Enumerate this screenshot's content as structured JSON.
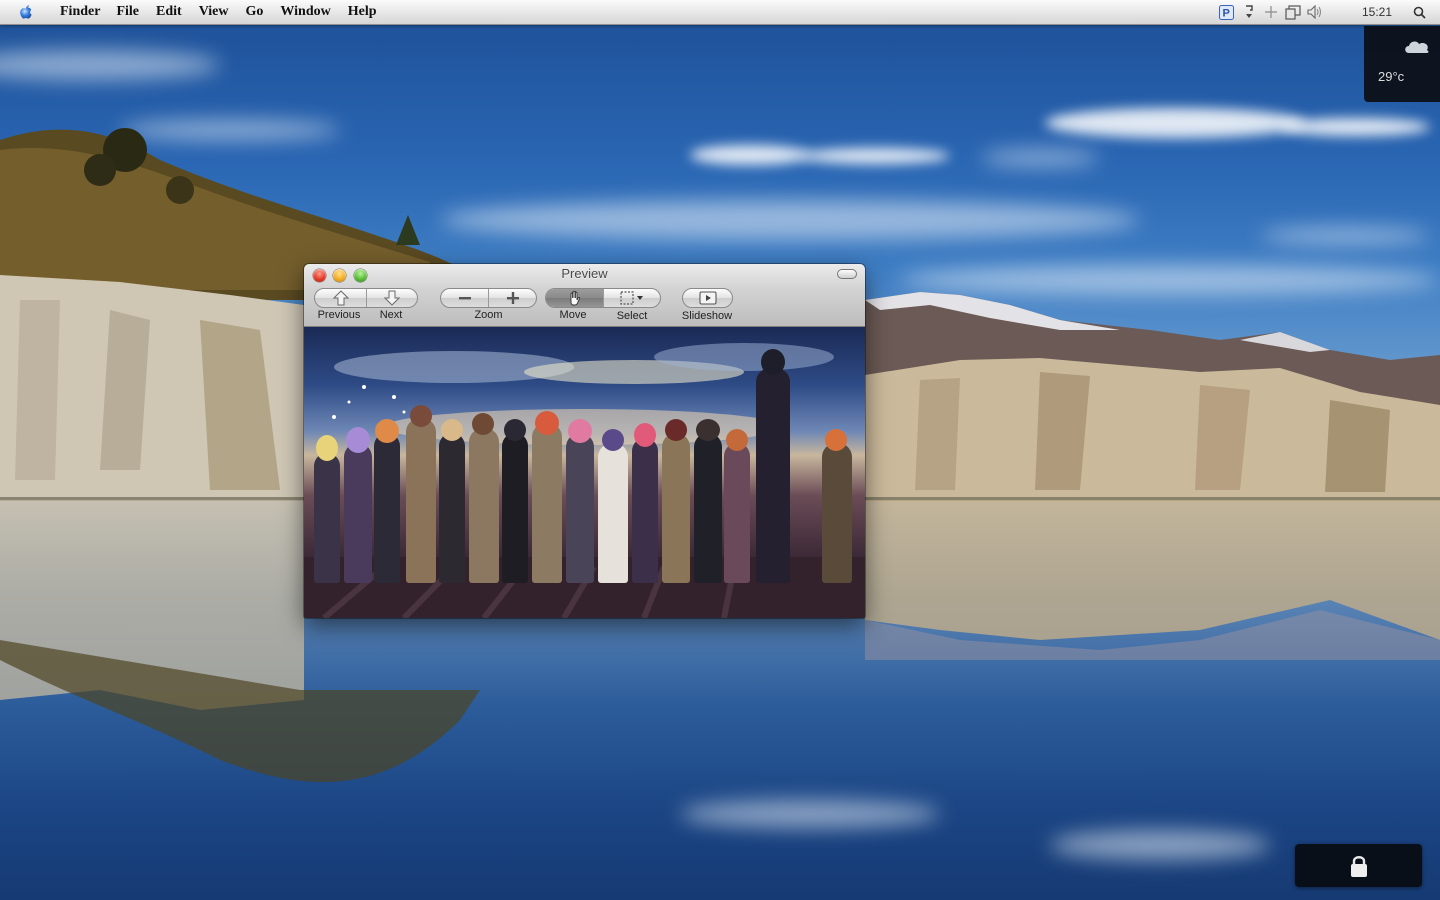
{
  "menubar": {
    "apple_icon": "apple-logo-icon",
    "app_name": "Finder",
    "menus": [
      "File",
      "Edit",
      "View",
      "Go",
      "Window",
      "Help"
    ],
    "status_icons": [
      "paw-icon",
      "sync-icon",
      "bluetooth-icon",
      "display-icon",
      "volume-icon"
    ],
    "clock": "15:21",
    "spotlight_icon": "spotlight-icon"
  },
  "weather_widget": {
    "temperature": "29°c",
    "icon": "cloud-icon"
  },
  "lock_widget": {
    "icon": "lock-icon"
  },
  "preview_window": {
    "title": "Preview",
    "toolbar": {
      "previous_label": "Previous",
      "next_label": "Next",
      "zoom_label": "Zoom",
      "move_label": "Move",
      "select_label": "Select",
      "slideshow_label": "Slideshow"
    }
  },
  "colors": {
    "menubar_bg": "#e6e6e6",
    "close": "#e0321f",
    "minimize": "#f0a81b",
    "zoom": "#4fb82c"
  }
}
